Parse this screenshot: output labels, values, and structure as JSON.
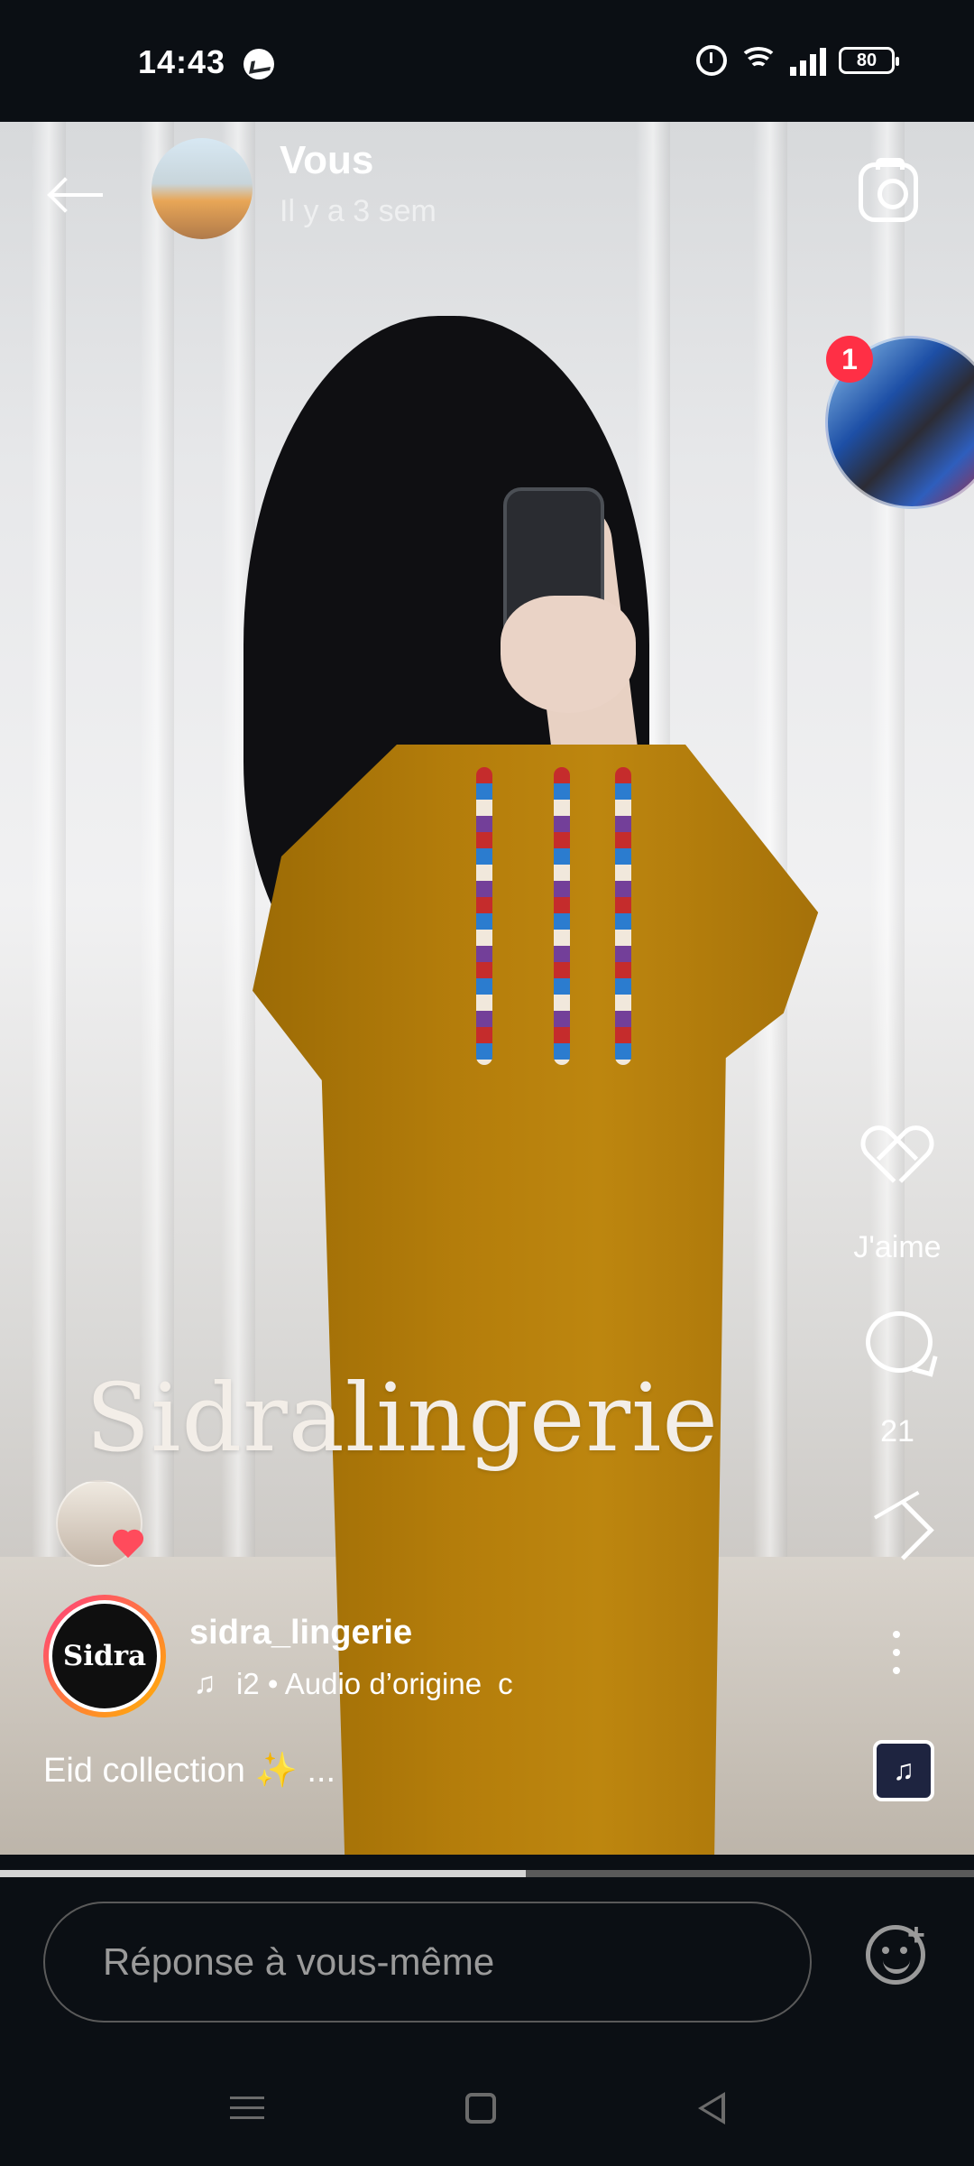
{
  "status": {
    "time": "14:43",
    "battery": "80",
    "icons": [
      "messenger-icon",
      "alarm-icon",
      "wifi-icon",
      "signal-icon",
      "battery-icon"
    ]
  },
  "story": {
    "username": "Vous",
    "time_ago": "Il y a 3 sem",
    "watermark": "Sidralingerie",
    "badge_count": "1"
  },
  "actions": {
    "like_label": "J'aime",
    "comment_count": "21"
  },
  "post": {
    "creator": "sidra_lingerie",
    "audio": "i2 • Audio d’origine",
    "audio_extra": "c",
    "caption": "Eid collection ✨ ..."
  },
  "progress": {
    "value": 0.54
  },
  "reply": {
    "placeholder": "Réponse à vous-même"
  },
  "colors": {
    "dark": "#0b0f14",
    "accent_pink": "#ff2f45",
    "dress_mustard": "#b47d0b",
    "progress_fill": "#d5d5d5",
    "muted_gray": "#9a9a9a"
  }
}
